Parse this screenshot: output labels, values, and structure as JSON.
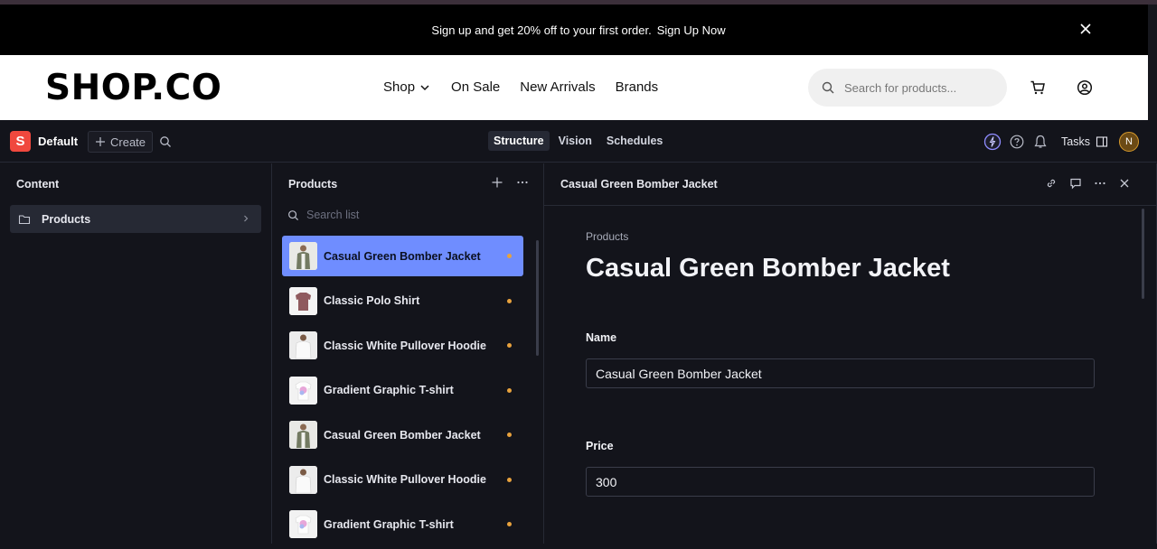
{
  "promo": {
    "text": "Sign up and get 20% off to your first order.",
    "link": "Sign Up Now"
  },
  "store": {
    "logo": "SHOP.CO",
    "nav": [
      "Shop",
      "On Sale",
      "New Arrivals",
      "Brands"
    ],
    "search_placeholder": "Search for products..."
  },
  "studio": {
    "logo_letter": "S",
    "workspace": "Default",
    "create_label": "Create",
    "tabs": [
      "Structure",
      "Vision",
      "Schedules"
    ],
    "active_tab": "Structure",
    "tasks_label": "Tasks",
    "avatar_initial": "N"
  },
  "content_pane": {
    "title": "Content",
    "folder": "Products"
  },
  "list_pane": {
    "title": "Products",
    "search_placeholder": "Search list",
    "items": [
      {
        "name": "Casual Green Bomber Jacket",
        "thumb": "jacket"
      },
      {
        "name": "Classic Polo Shirt",
        "thumb": "polo"
      },
      {
        "name": "Classic White Pullover Hoodie",
        "thumb": "hoodie"
      },
      {
        "name": "Gradient Graphic T-shirt",
        "thumb": "tshirt"
      },
      {
        "name": "Casual Green Bomber Jacket",
        "thumb": "jacket"
      },
      {
        "name": "Classic White Pullover Hoodie",
        "thumb": "hoodie"
      },
      {
        "name": "Gradient Graphic T-shirt",
        "thumb": "tshirt"
      }
    ]
  },
  "document": {
    "header": "Casual Green Bomber Jacket",
    "breadcrumb": "Products",
    "title": "Casual Green Bomber Jacket",
    "fields": [
      {
        "label": "Name",
        "value": "Casual Green Bomber Jacket"
      },
      {
        "label": "Price",
        "value": "300"
      }
    ]
  },
  "colors": {
    "accent": "#6f8dff",
    "status_dot": "#e8a23d",
    "brand_red": "#f0483e"
  }
}
